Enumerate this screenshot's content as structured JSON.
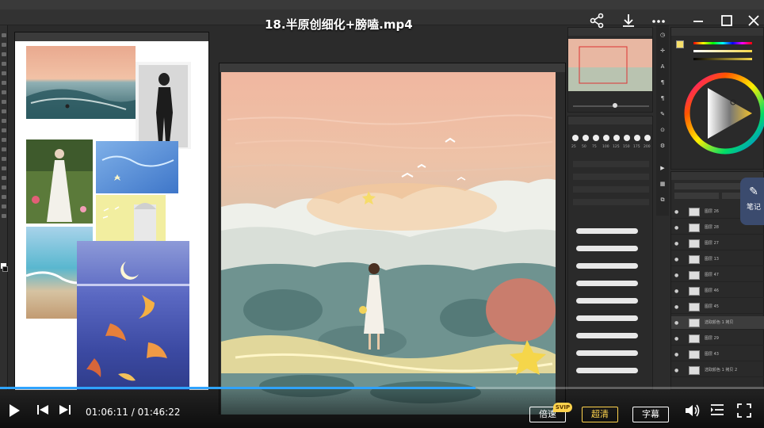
{
  "video": {
    "title": "18.半原创细化+膀嗑.mp4",
    "current_time": "01:06:11",
    "total_time": "01:46:22",
    "time_separator": " / ",
    "progress_fraction": 0.622
  },
  "controls": {
    "speed_label": "倍速",
    "vip_badge": "SVIP",
    "quality_label": "超清",
    "subtitle_label": "字幕",
    "note_label": "笔记"
  },
  "colors": {
    "progress": "#2fa3ff",
    "active_quality": "#ffd34d",
    "vip_badge": "#ffd34d"
  },
  "icons": {
    "share": "share-icon",
    "download": "download-icon",
    "more": "more-icon",
    "minimize": "minimize-icon",
    "maximize": "maximize-icon",
    "close": "close-icon",
    "play": "play-icon",
    "prev": "previous-icon",
    "next": "next-icon",
    "volume": "volume-icon",
    "playlist": "playlist-icon",
    "fullscreen": "fullscreen-icon"
  },
  "ps": {
    "brush_sizes": [
      "25",
      "50",
      "75",
      "100",
      "125",
      "150",
      "175",
      "200"
    ],
    "layers": [
      "图层 26",
      "图层 28",
      "图层 27",
      "图层 13",
      "图层 47",
      "图层 46",
      "图层 45",
      "选取颜色 1 拷贝",
      "图层 29",
      "图层 43",
      "选取颜色 1 拷贝 2"
    ]
  }
}
